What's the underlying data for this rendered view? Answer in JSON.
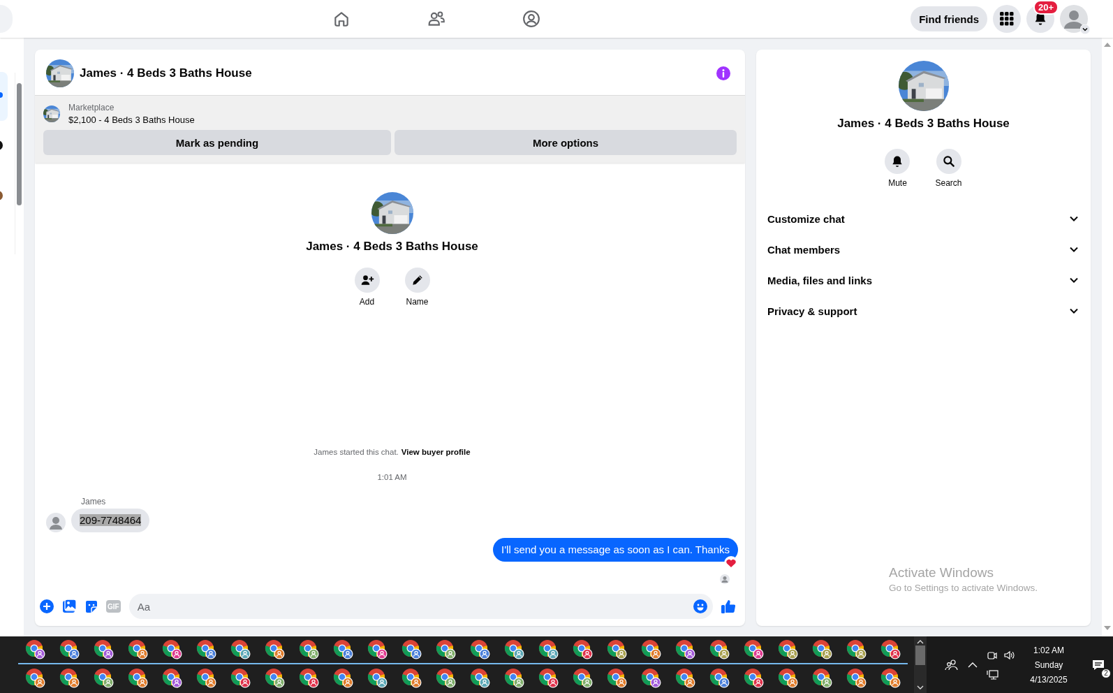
{
  "top_bar": {
    "find_friends": "Find friends",
    "notification_count": "20+"
  },
  "chat": {
    "title": "James · 4 Beds 3 Baths House",
    "listing": {
      "label": "Marketplace",
      "title": "$2,100 - 4 Beds 3 Baths House",
      "buttons": [
        "Mark as pending",
        "More options"
      ]
    },
    "intro": {
      "name": "James · 4 Beds 3 Baths House",
      "actions": [
        {
          "kind": "add",
          "label": "Add"
        },
        {
          "kind": "name",
          "label": "Name"
        }
      ]
    },
    "system_note": {
      "text": "James started this chat.",
      "link": "View buyer profile"
    },
    "timestamp": "1:01 AM",
    "messages": [
      {
        "kind": "received",
        "sender": "James",
        "text": "209-7748464",
        "highlighted": true
      },
      {
        "kind": "sent",
        "text": "I'll send you a message as soon as I can. Thanks",
        "reaction": true,
        "seen": true
      }
    ],
    "composer": {
      "placeholder": "Aa",
      "gif_label": "GIF"
    }
  },
  "details": {
    "name": "James · 4 Beds 3 Baths House",
    "actions": [
      {
        "kind": "mute",
        "label": "Mute"
      },
      {
        "kind": "search",
        "label": "Search"
      }
    ],
    "sections": [
      {
        "label": "Customize chat",
        "expanded": false
      },
      {
        "label": "Chat members",
        "expanded": false
      },
      {
        "label": "Media, files and links",
        "expanded": false
      },
      {
        "label": "Privacy & support",
        "expanded": false
      }
    ]
  },
  "os_notice": {
    "title": "Activate Windows",
    "text": "Go to Settings to activate Windows."
  },
  "taskbar": {
    "rows": [
      [
        {
          "color": "#a259d9"
        },
        {
          "color": "#4a7fd9"
        },
        {
          "color": "#a259d9"
        },
        {
          "color": "#e07b2a"
        },
        {
          "color": "#e0398f"
        },
        {
          "color": "#4a7fd9"
        },
        {
          "color": "#5aa7b5"
        },
        {
          "color": "#e07b2a"
        },
        {
          "color": "#7fae6a"
        },
        {
          "color": "#4a7fd9"
        },
        {
          "color": "#e0398f"
        },
        {
          "color": "#4a7fd9"
        },
        {
          "color": "#7fae6a"
        },
        {
          "color": "#4a7fd9"
        },
        {
          "color": "#5aa7b5"
        },
        {
          "color": "#5aa7b5"
        },
        {
          "color": "#e0304a"
        },
        {
          "color": "#a8a04f"
        },
        {
          "color": "#e07b2a"
        },
        {
          "color": "#a259d9"
        },
        {
          "color": "#a8a04f"
        },
        {
          "color": "#e0398f"
        },
        {
          "color": "#a8a04f"
        },
        {
          "color": "#a8a04f"
        },
        {
          "color": "#a8a04f"
        },
        {
          "color": "#e0304a"
        }
      ],
      [
        {
          "color": "#e07b2a"
        },
        {
          "color": "#e07b2a"
        },
        {
          "color": "#7fae6a"
        },
        {
          "color": "#e07b2a"
        },
        {
          "color": "#a259d9"
        },
        {
          "color": "#e07b2a"
        },
        {
          "color": "#e0304a"
        },
        {
          "color": "#7fae6a"
        },
        {
          "color": "#e0304a"
        },
        {
          "color": "#e07b2a"
        },
        {
          "color": "#5aa7b5"
        },
        {
          "color": "#e07b2a"
        },
        {
          "color": "#7fae6a"
        },
        {
          "color": "#5aa7b5"
        },
        {
          "color": "#7fae6a"
        },
        {
          "color": "#e0304a"
        },
        {
          "color": "#7fae6a"
        },
        {
          "color": "#e07b2a"
        },
        {
          "color": "#a259d9"
        },
        {
          "color": "#e07b2a"
        },
        {
          "color": "#4a7fd9"
        },
        {
          "color": "#e0304a"
        },
        {
          "color": "#e07b2a"
        },
        {
          "color": "#7fae6a"
        },
        {
          "color": "#e07b2a"
        },
        {
          "color": "#e07b2a"
        }
      ]
    ],
    "tray": {
      "time": "1:02 AM",
      "day": "Sunday",
      "date": "4/13/2025",
      "notifications": "2"
    }
  }
}
